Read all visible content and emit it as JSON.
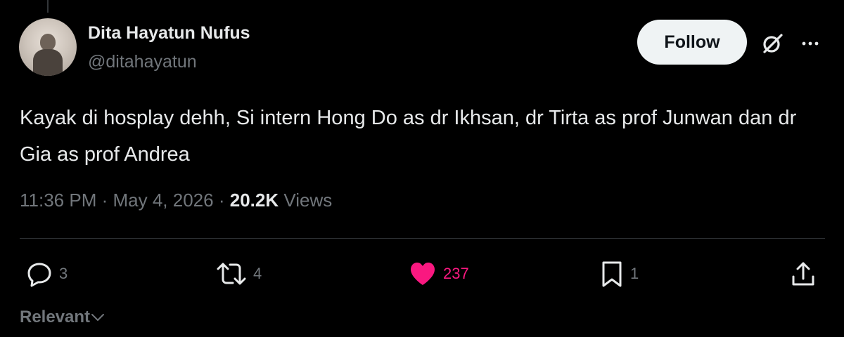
{
  "author": {
    "display_name": "Dita Hayatun Nufus",
    "handle": "@ditahayatun"
  },
  "follow_label": "Follow",
  "tweet": {
    "text": "Kayak di hosplay dehh, Si intern Hong Do as dr Ikhsan, dr Tirta as prof Junwan dan dr Gia as prof Andrea",
    "time": "11:36 PM",
    "separator": "·",
    "date": "May 4, 2026",
    "views_count": "20.2K",
    "views_label": "Views"
  },
  "actions": {
    "replies": "3",
    "reposts": "4",
    "likes": "237",
    "bookmarks": "1"
  },
  "sort_label": "Relevant",
  "colors": {
    "background": "#000000",
    "text": "#e7e9ea",
    "muted": "#71767b",
    "like": "#f91880",
    "follow_bg": "#eff3f4"
  },
  "icons": [
    "reply-icon",
    "repost-icon",
    "heart-icon",
    "bookmark-icon",
    "share-icon",
    "grok-icon",
    "more-icon",
    "chevron-down-icon"
  ]
}
